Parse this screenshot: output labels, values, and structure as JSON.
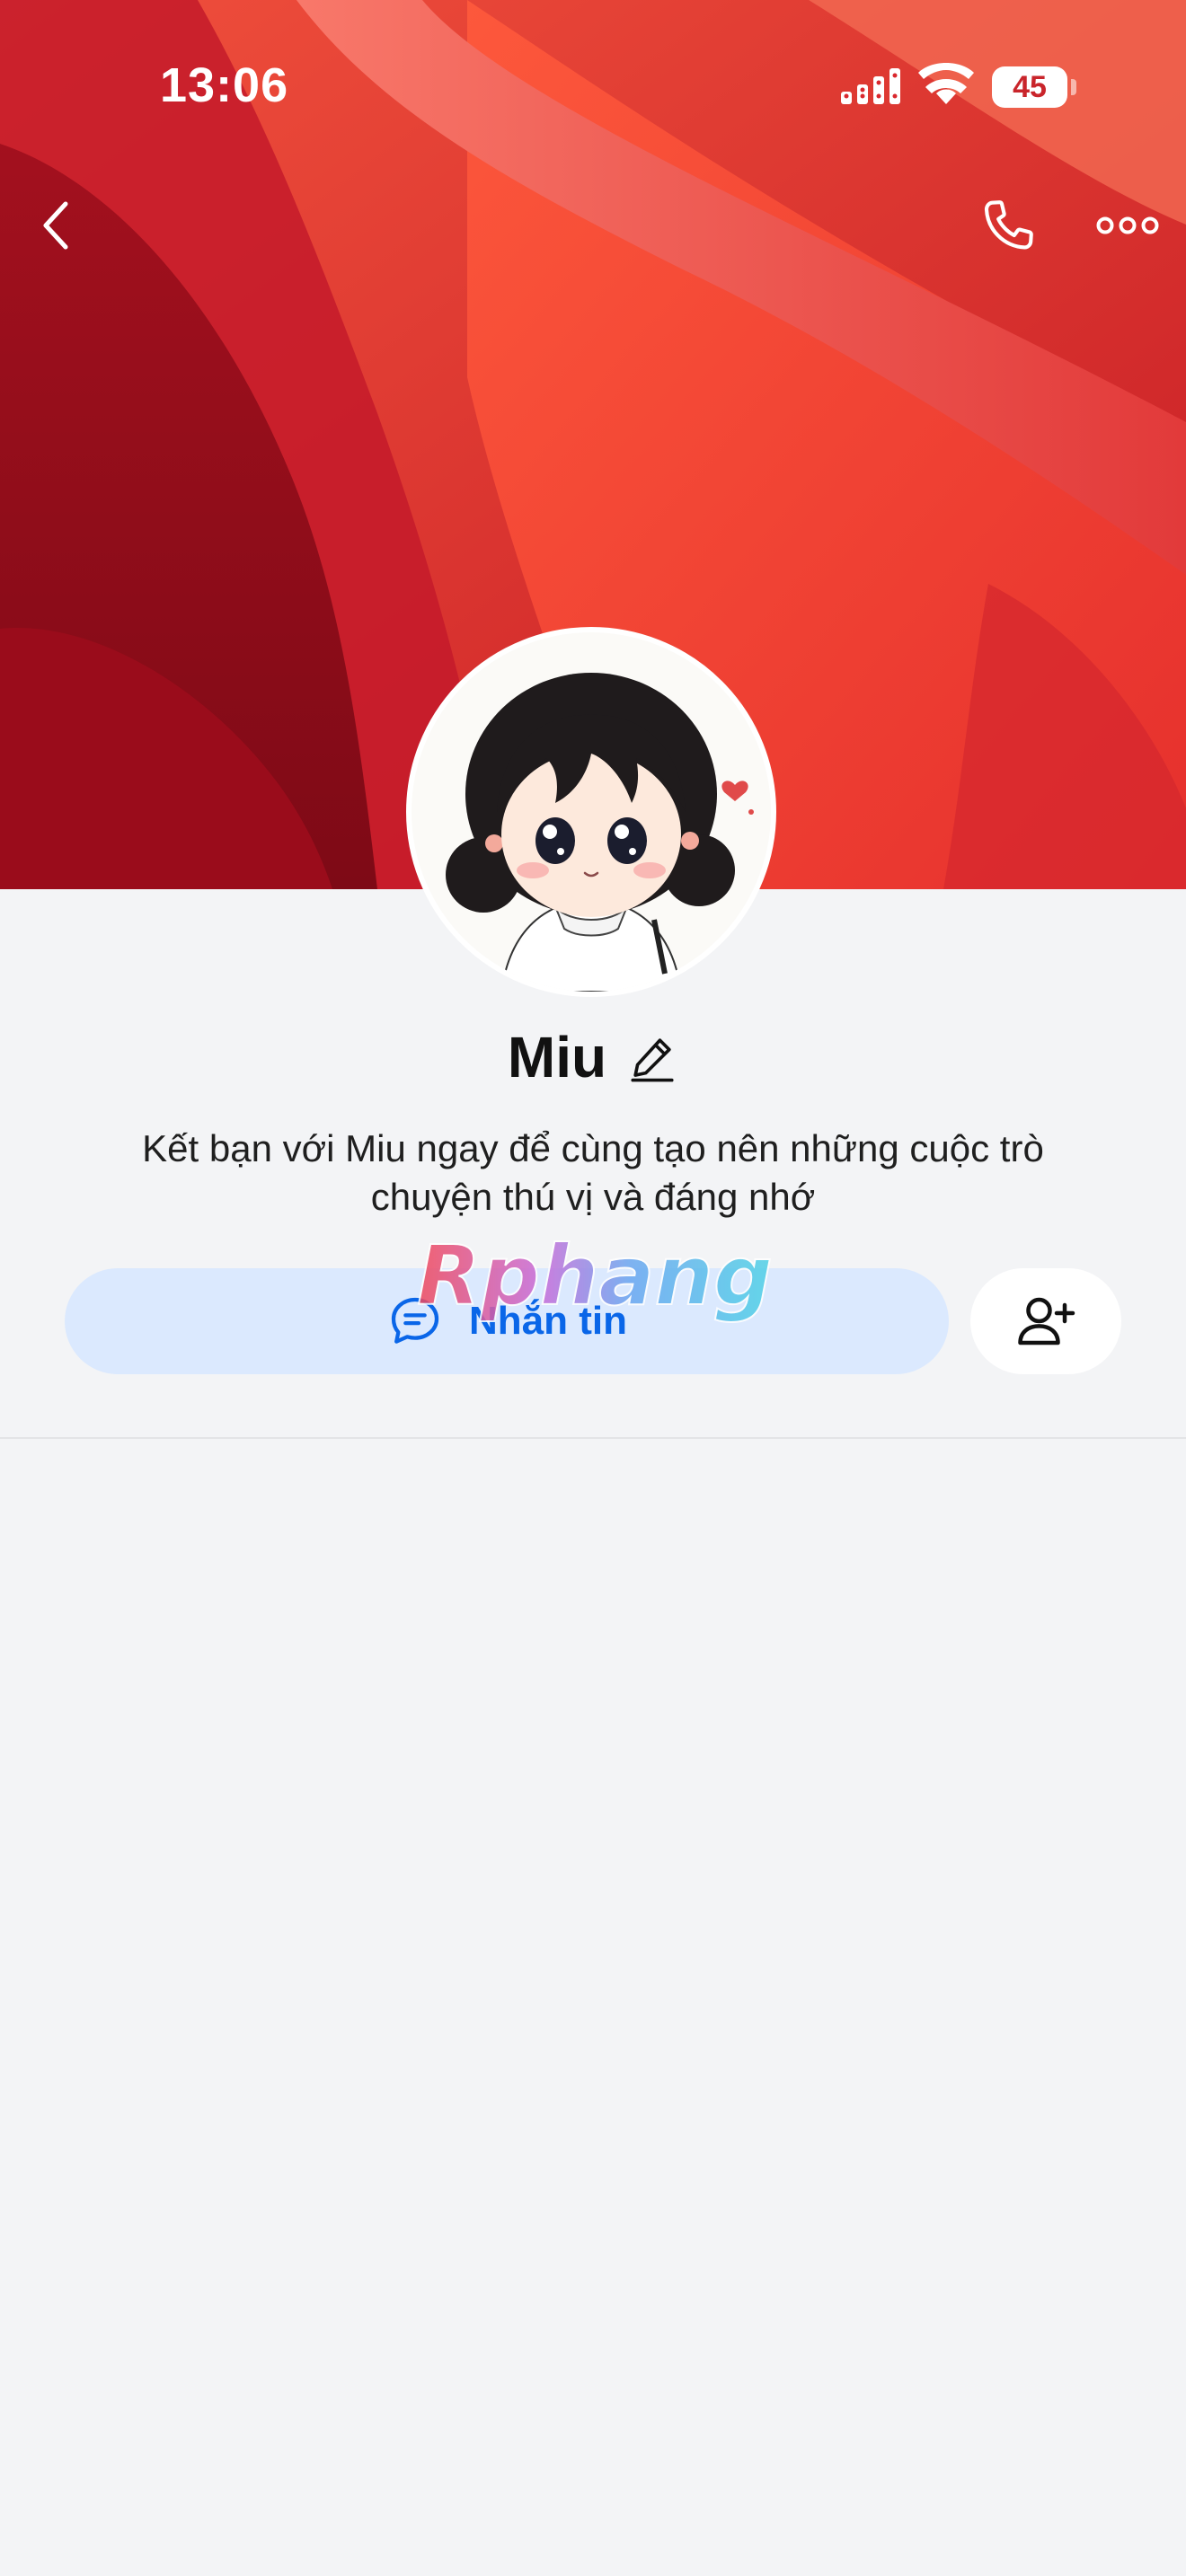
{
  "status_bar": {
    "time": "13:06",
    "battery_level": "45",
    "battery_fraction": 0.45
  },
  "nav": {
    "back_icon": "chevron-left-icon",
    "call_icon": "phone-icon",
    "more_icon": "more-horizontal-icon"
  },
  "profile": {
    "name": "Miu",
    "bio": "Kết bạn với Miu ngay để cùng tạo nên những cuộc trò chuyện thú vị và đáng nhớ"
  },
  "actions": {
    "message_label": "Nhắn tin",
    "message_icon": "chat-bubble-icon",
    "add_friend_icon": "add-user-icon"
  },
  "watermark": {
    "text": "Rphang"
  },
  "colors": {
    "accent": "#0a66e8",
    "message_button_bg": "#dbe9fe",
    "page_bg": "#f3f4f6",
    "cover": "#d92a2f"
  }
}
